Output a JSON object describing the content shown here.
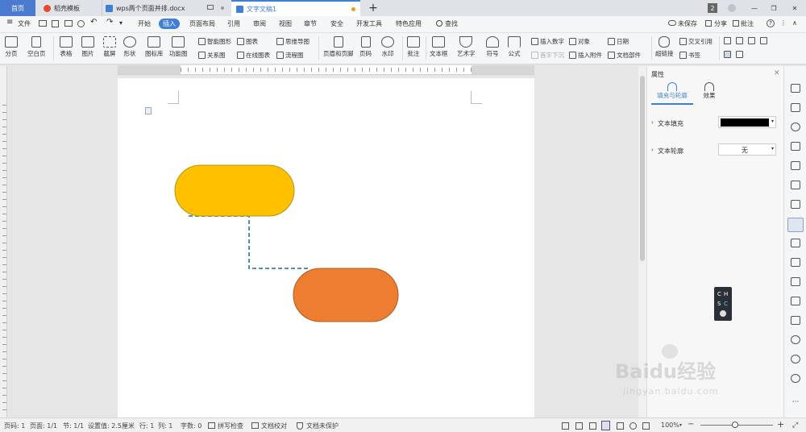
{
  "tabs": {
    "home": "首页",
    "templates": "稻壳模板",
    "doc1": "wps两个页面并排.docx",
    "doc2": "文字文稿1",
    "badge": "2"
  },
  "menu": {
    "file": "文件",
    "items": [
      "开始",
      "插入",
      "页面布局",
      "引用",
      "审阅",
      "视图",
      "章节",
      "安全",
      "开发工具",
      "特色应用"
    ],
    "active": "插入",
    "search": "查找",
    "unsaved": "未保存",
    "share": "分享",
    "comment": "批注",
    "help": "?"
  },
  "ribbon": {
    "page_break": "分页",
    "blank_page": "空白页",
    "table": "表格",
    "picture": "图片",
    "screenshot": "截屏",
    "shape": "形状",
    "icon_lib": "图标库",
    "func_chart": "功能图",
    "smart_art": "智能图形",
    "chart": "图表",
    "mind_map": "思维导图",
    "relation": "关系图",
    "online_chart": "在线图表",
    "flowchart": "流程图",
    "header_footer": "页眉和页脚",
    "page_num": "页码",
    "watermark": "水印",
    "annotation": "批注",
    "textbox": "文本框",
    "art_text": "艺术字",
    "symbol": "符号",
    "formula": "公式",
    "insert_number": "插入数字",
    "object": "对象",
    "date": "日期",
    "drop_cap": "首字下沉",
    "attachment": "插入附件",
    "doc_part": "文档部件",
    "hyperlink": "超链接",
    "cross_ref": "交叉引用",
    "bookmark": "书签"
  },
  "panel": {
    "title": "属性",
    "tab_fill": "填充与轮廓",
    "tab_effect": "效果",
    "text_fill_label": "文本填充",
    "text_outline_label": "文本轮廓",
    "text_outline_value": "无",
    "fill_color": "#000000"
  },
  "ime": [
    "C",
    "H",
    "S",
    "C"
  ],
  "watermark": {
    "brand": "Baidu经验",
    "url": "jingyan.baidu.com"
  },
  "status": {
    "page_no": "页码: 1",
    "pages": "页面: 1/1",
    "section": "节: 1/1",
    "setting": "设置值: 2.5厘米",
    "row": "行: 1",
    "col": "列: 1",
    "words": "字数: 0",
    "spell": "拼写检查",
    "proof": "文档校对",
    "protect": "文档未保护",
    "zoom": "100%"
  },
  "shapes": {
    "top_color": "#FFC000",
    "bottom_color": "#ED7D31",
    "connector_color": "#5A8AB8"
  }
}
